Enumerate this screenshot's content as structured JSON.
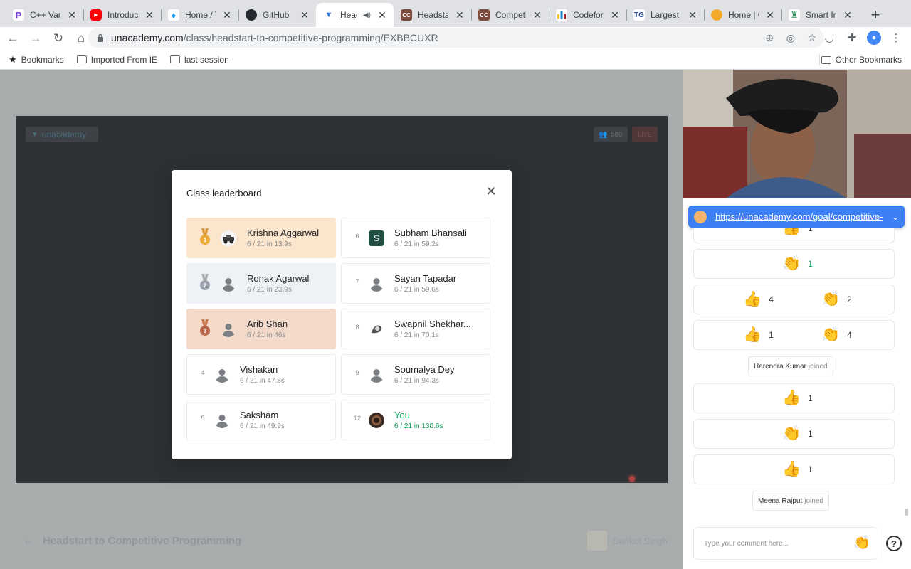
{
  "browser": {
    "tabs": [
      {
        "title": "C++ Variat",
        "fav_color": "#7a3ddb",
        "fav_glyph": "P"
      },
      {
        "title": "Introductio",
        "fav_color": "#ff0000",
        "fav_glyph": "▶"
      },
      {
        "title": "Home / Tw",
        "fav_color": "#1d9bf0",
        "fav_glyph": "t"
      },
      {
        "title": "GitHub",
        "fav_color": "#24292f",
        "fav_glyph": "◉"
      },
      {
        "title": "Heads",
        "fav_color": "#2c6fde",
        "fav_glyph": "▼"
      },
      {
        "title": "Headstart",
        "fav_color": "#7b4a3a",
        "fav_glyph": "CC"
      },
      {
        "title": "Competiti",
        "fav_color": "#7b4a3a",
        "fav_glyph": "CC"
      },
      {
        "title": "Codeforce",
        "fav_color": "#1f8acb",
        "fav_glyph": "▮"
      },
      {
        "title": "Largest Te",
        "fav_color": "#ffffff",
        "fav_glyph": "TG"
      },
      {
        "title": "Home | Go",
        "fav_color": "#f4a92b",
        "fav_glyph": "✺"
      },
      {
        "title": "Smart Indi",
        "fav_color": "#ffffff",
        "fav_glyph": "🏛"
      }
    ],
    "active_tab_index": 4,
    "new_tab_label": "+",
    "url_host": "unacademy.com",
    "url_path": "/class/headstart-to-competitive-programming/EXBBCUXR",
    "bookmarks": {
      "star_label": "Bookmarks",
      "folder1": "Imported From IE",
      "folder2": "last session",
      "other": "Other Bookmarks"
    }
  },
  "player": {
    "brand": "unacademy",
    "viewers": "580",
    "live": "LIVE"
  },
  "course": {
    "title": "Headstart to Competitive Programming",
    "educator": "Sanket Singh"
  },
  "leaderboard": {
    "title": "Class leaderboard",
    "entries": [
      {
        "rank": "1",
        "name": "Krishna Aggarwal",
        "score": "6 / 21 in 13.9s"
      },
      {
        "rank": "2",
        "name": "Ronak Agarwal",
        "score": "6 / 21 in 23.9s"
      },
      {
        "rank": "3",
        "name": "Arib Shan",
        "score": "6 / 21 in 46s"
      },
      {
        "rank": "4",
        "name": "Vishakan",
        "score": "6 / 21 in 47.8s"
      },
      {
        "rank": "5",
        "name": "Saksham",
        "score": "6 / 21 in 49.9s"
      },
      {
        "rank": "6",
        "name": "Subham Bhansali",
        "score": "6 / 21 in 59.2s",
        "avatar_letter": "S"
      },
      {
        "rank": "7",
        "name": "Sayan Tapadar",
        "score": "6 / 21 in 59.6s"
      },
      {
        "rank": "8",
        "name": "Swapnil Shekhar...",
        "score": "6 / 21 in 70.1s"
      },
      {
        "rank": "9",
        "name": "Soumalya Dey",
        "score": "6 / 21 in 94.3s"
      },
      {
        "rank": "12",
        "name": "You",
        "score": "6 / 21 in 130.6s"
      }
    ]
  },
  "side": {
    "pinned_link": "https://unacademy.com/goal/competitive-programming",
    "feed": {
      "r0": {
        "a": "1"
      },
      "r1": {
        "a": "1"
      },
      "r2": {
        "a": "4",
        "b": "2"
      },
      "r3": {
        "a": "1",
        "b": "4"
      },
      "j1": {
        "name": "Harendra Kumar",
        "action": "joined"
      },
      "r4": {
        "a": "1"
      },
      "r5": {
        "a": "1"
      },
      "r6": {
        "a": "1"
      },
      "j2": {
        "name": "Meena Rajput",
        "action": "joined"
      }
    },
    "comment_placeholder": "Type your comment here...",
    "help": "?"
  },
  "colors": {
    "you": "#08a45b",
    "pinned_bg": "#3d7ff5",
    "gold_card": "#fbe5cd",
    "silver_card": "#eef1f5",
    "bronze_card": "#f3d9c9"
  },
  "icons": {
    "thumbs_up": "👍",
    "clap": "👏"
  }
}
